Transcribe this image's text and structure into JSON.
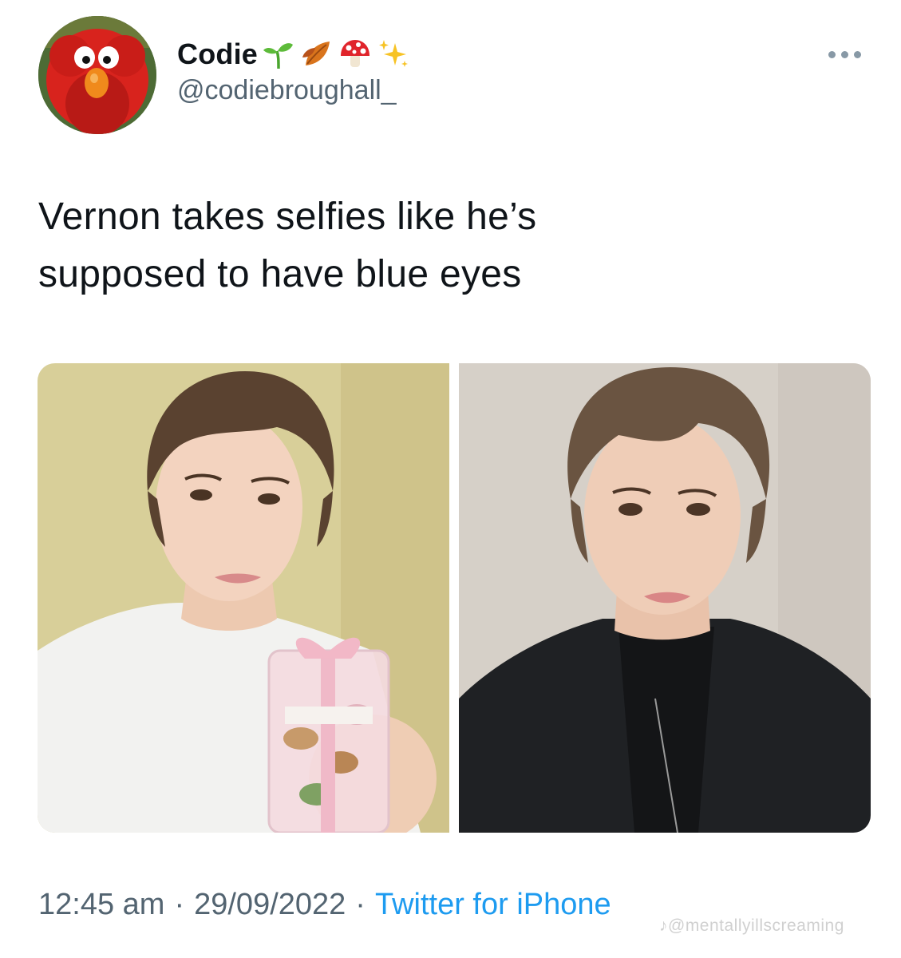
{
  "tweet": {
    "author": {
      "display_name": "Codie",
      "name_emojis": [
        "seedling-emoji",
        "fallen-leaf-emoji",
        "mushroom-emoji",
        "sparkles-emoji"
      ],
      "handle": "@codiebroughall_",
      "avatar": "elmo-avatar"
    },
    "text_line1": "Vernon takes selfies like he’s",
    "text_line2": "supposed to have blue eyes",
    "media": [
      {
        "name": "selfie-white-tshirt-gift-jar"
      },
      {
        "name": "selfie-black-jacket"
      }
    ],
    "time": "12:45 am",
    "separator": "·",
    "date": "29/09/2022",
    "source": "Twitter for iPhone"
  },
  "watermark": "♪@mentallyillscreaming",
  "colors": {
    "text": "#0f1419",
    "secondary": "#536471",
    "link": "#1d9bf0"
  }
}
